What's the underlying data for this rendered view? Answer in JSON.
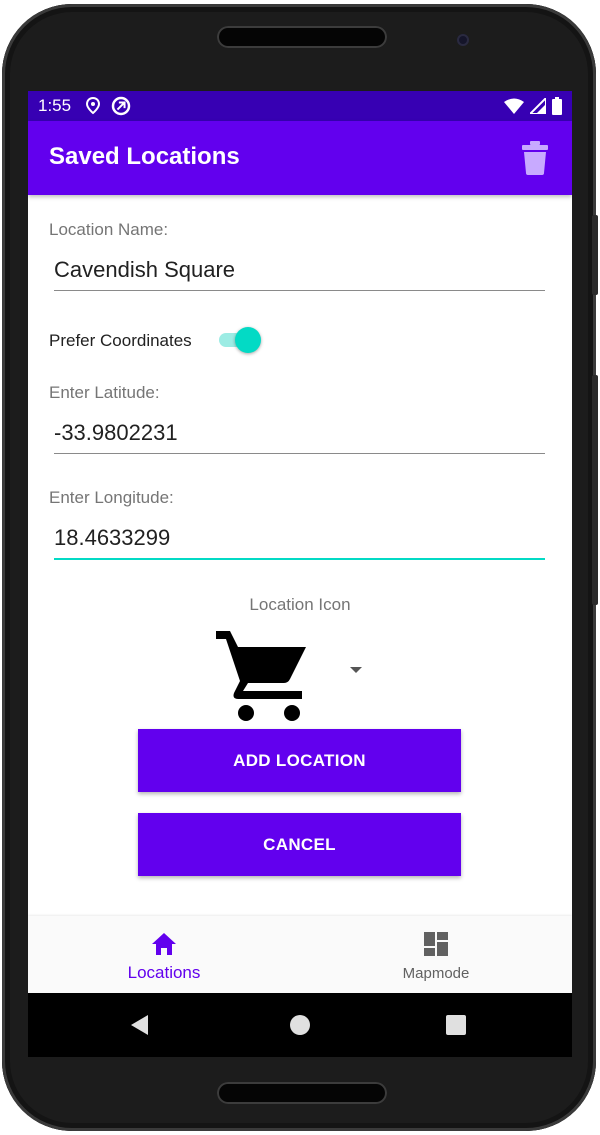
{
  "status_bar": {
    "time": "1:55",
    "icons": [
      "location-icon",
      "sync-icon",
      "wifi-icon",
      "signal-icon",
      "battery-icon"
    ]
  },
  "app_bar": {
    "title": "Saved Locations",
    "action_icon": "trash-icon"
  },
  "form": {
    "location_name": {
      "label": "Location Name:",
      "value": "Cavendish Square"
    },
    "prefer_coordinates": {
      "label": "Prefer Coordinates",
      "enabled": true
    },
    "latitude": {
      "label": "Enter Latitude:",
      "value": "-33.9802231"
    },
    "longitude": {
      "label": "Enter Longitude:",
      "value": "18.4633299"
    },
    "location_icon": {
      "label": "Location Icon",
      "selected_icon": "shopping-cart-icon"
    }
  },
  "buttons": {
    "add_location": "ADD LOCATION",
    "cancel": "CANCEL"
  },
  "bottom_nav": {
    "items": [
      {
        "label": "Locations",
        "icon": "home-icon",
        "active": true
      },
      {
        "label": "Mapmode",
        "icon": "dashboard-icon",
        "active": false
      }
    ]
  },
  "system_nav": {
    "icons": [
      "back-icon",
      "home-circle-icon",
      "recents-icon"
    ]
  },
  "colors": {
    "primary": "#6200ee",
    "primary_dark": "#3700b3",
    "accent": "#03dac5"
  }
}
